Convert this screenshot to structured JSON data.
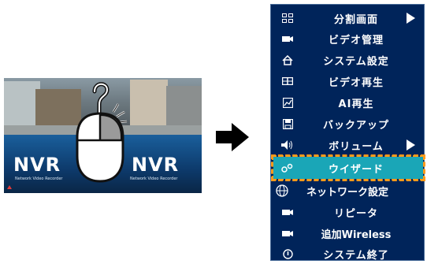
{
  "preview": {
    "logo_left": "NVR",
    "subtitle_left": "Network Video Recorder",
    "logo_right": "NVR",
    "subtitle_right": "Network Video Recorder"
  },
  "menu": {
    "items": [
      {
        "label": "分割画面",
        "icon": "grid-icon",
        "submenu": true
      },
      {
        "label": "ビデオ管理",
        "icon": "camera-icon",
        "submenu": false
      },
      {
        "label": "システム設定",
        "icon": "home-icon",
        "submenu": false
      },
      {
        "label": "ビデオ再生",
        "icon": "film-icon",
        "submenu": false
      },
      {
        "label": "AI再生",
        "icon": "chart-icon",
        "submenu": false
      },
      {
        "label": "バックアップ",
        "icon": "floppy-icon",
        "submenu": false
      },
      {
        "label": "ボリューム",
        "icon": "speaker-icon",
        "submenu": true
      },
      {
        "label": "ウイザード",
        "icon": "gears-icon",
        "submenu": false,
        "selected": true
      },
      {
        "label": "ネットワーク設定",
        "icon": "globe-icon",
        "submenu": false
      },
      {
        "label": "リピータ",
        "icon": "camera-icon",
        "submenu": false
      },
      {
        "label": "追加Wireless",
        "icon": "camera-icon",
        "submenu": false
      },
      {
        "label": "システム終了",
        "icon": "power-icon",
        "submenu": false
      }
    ]
  },
  "colors": {
    "menu_bg": "#00245a",
    "selected_bg": "#1aa6b7",
    "selected_frame": "#f39c12"
  }
}
